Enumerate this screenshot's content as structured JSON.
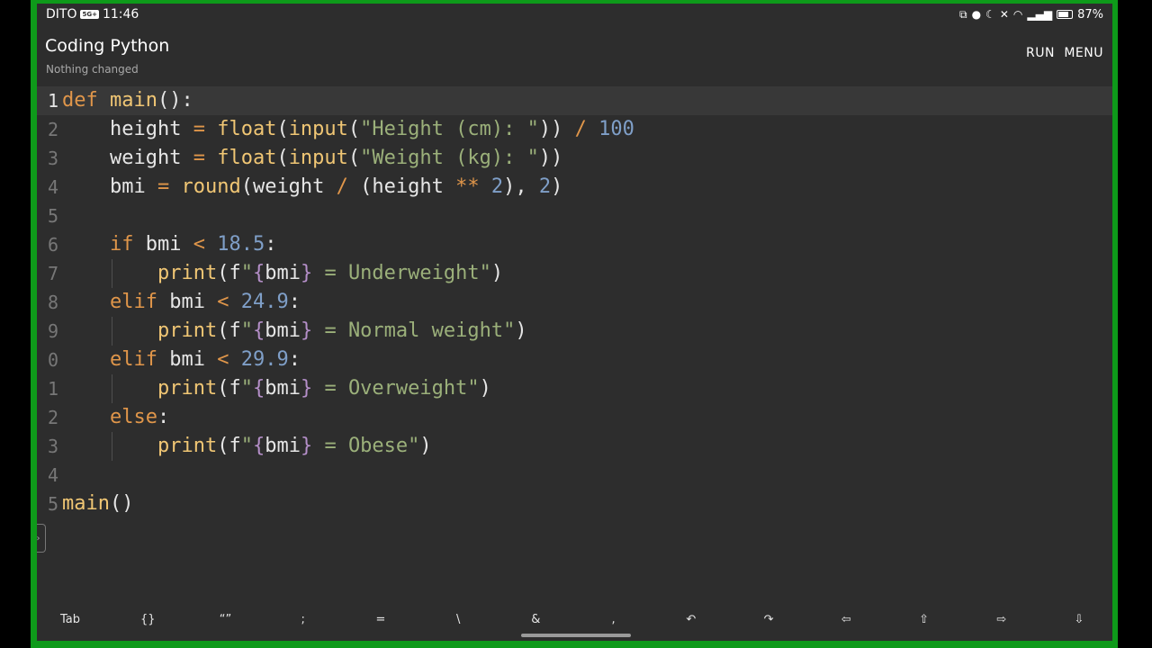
{
  "status": {
    "carrier": "DITO",
    "network_badge": "5G+",
    "time": "11:46",
    "battery": "87%",
    "icons": [
      "cast-icon",
      "mic-icon",
      "dnd-moon-icon",
      "mute-icon",
      "wifi-icon",
      "signal-icon",
      "battery-icon"
    ]
  },
  "app": {
    "title": "Coding Python",
    "subtitle": "Nothing changed",
    "run_label": "RUN",
    "menu_label": "MENU"
  },
  "editor": {
    "language": "python",
    "current_line": 1,
    "gutter": [
      "1",
      "2",
      "3",
      "4",
      "5",
      "6",
      "7",
      "8",
      "9",
      "0",
      "1",
      "2",
      "3",
      "4",
      "5"
    ],
    "lines": [
      "def main():",
      "    height = float(input(\"Height (cm): \")) / 100",
      "    weight = float(input(\"Weight (kg): \"))",
      "    bmi = round(weight / (height ** 2), 2)",
      "",
      "    if bmi < 18.5:",
      "        print(f\"{bmi} = Underweight\")",
      "    elif bmi < 24.9:",
      "        print(f\"{bmi} = Normal weight\")",
      "    elif bmi < 29.9:",
      "        print(f\"{bmi} = Overweight\")",
      "    else:",
      "        print(f\"{bmi} = Obese\")",
      "",
      "main()"
    ]
  },
  "keys": [
    {
      "name": "tab-key",
      "label": "Tab"
    },
    {
      "name": "braces-key",
      "label": "{}"
    },
    {
      "name": "quotes-key",
      "label": "“”"
    },
    {
      "name": "semicolon-key",
      "label": ";"
    },
    {
      "name": "equals-key",
      "label": "="
    },
    {
      "name": "backslash-key",
      "label": "\\"
    },
    {
      "name": "ampersand-key",
      "label": "&"
    },
    {
      "name": "comma-key",
      "label": ","
    },
    {
      "name": "undo-key",
      "label": "↶"
    },
    {
      "name": "redo-key",
      "label": "↷"
    },
    {
      "name": "left-arrow-key",
      "label": "⇦"
    },
    {
      "name": "shift-key",
      "label": "⇧"
    },
    {
      "name": "right-arrow-key",
      "label": "⇨"
    },
    {
      "name": "down-arrow-key",
      "label": "⇩"
    }
  ],
  "colors": {
    "frame": "#0e9a1a",
    "background": "#2d2d2d",
    "keyword": "#e0964a",
    "function": "#f0c674",
    "string": "#9bb07a",
    "number": "#7f9fc8"
  }
}
